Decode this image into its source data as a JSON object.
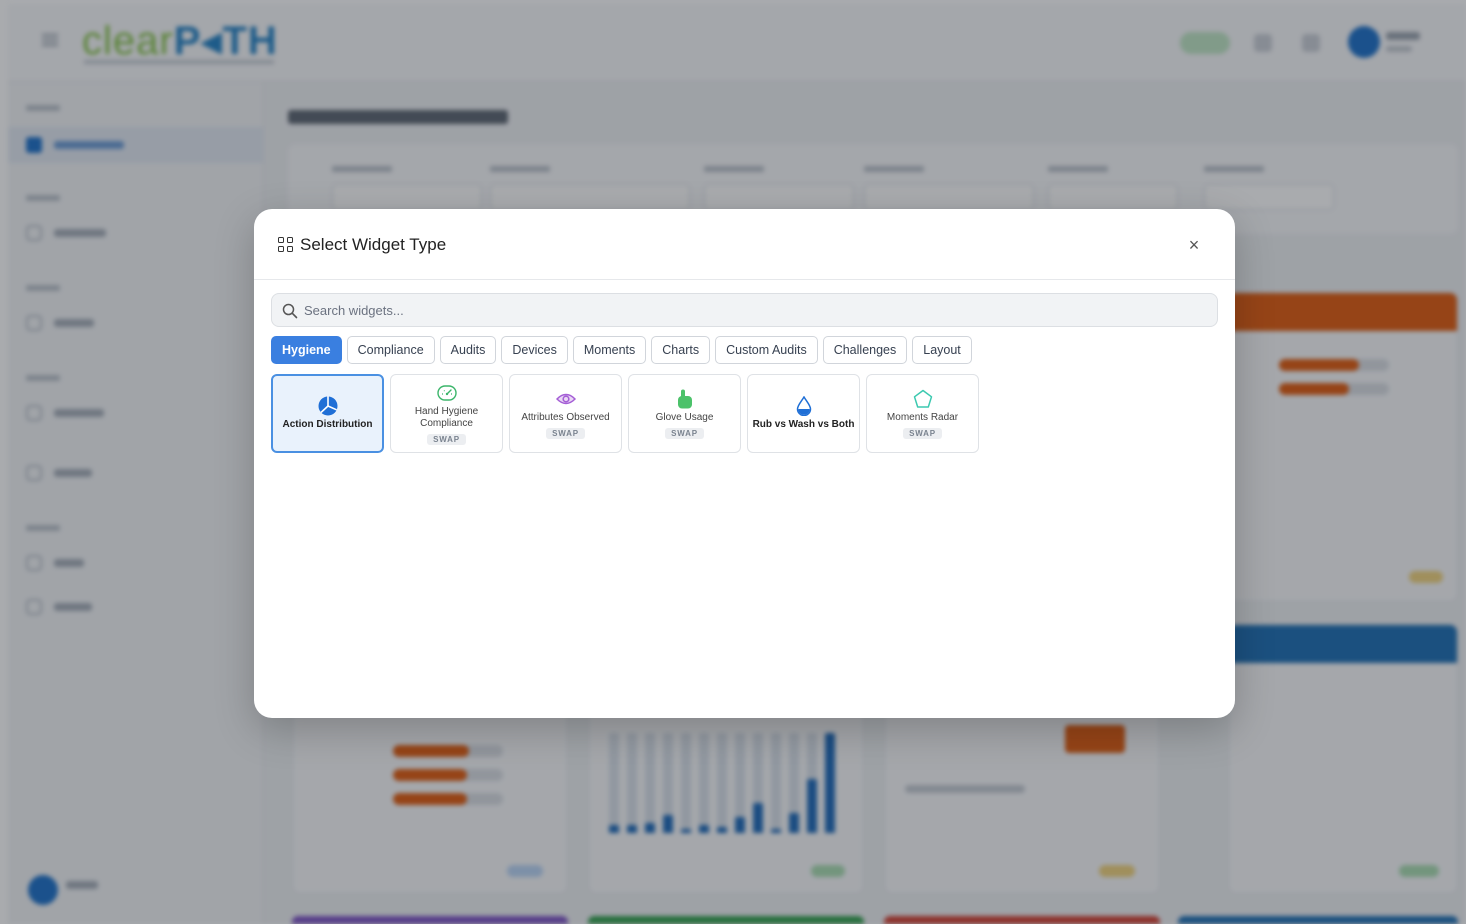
{
  "modal": {
    "title": "Select Widget Type",
    "close_label": "×",
    "search_placeholder": "Search widgets...",
    "tabs": [
      {
        "label": "Hygiene",
        "active": true
      },
      {
        "label": "Compliance"
      },
      {
        "label": "Audits"
      },
      {
        "label": "Devices"
      },
      {
        "label": "Moments"
      },
      {
        "label": "Charts"
      },
      {
        "label": "Custom Audits"
      },
      {
        "label": "Challenges"
      },
      {
        "label": "Layout"
      }
    ],
    "widgets": [
      {
        "label": "Action Distribution",
        "icon": "pie-chart-icon",
        "selected": true
      },
      {
        "label": "Hand Hygiene Compliance",
        "icon": "gauge-icon",
        "badge": "SWAP"
      },
      {
        "label": "Attributes Observed",
        "icon": "eye-icon",
        "badge": "SWAP"
      },
      {
        "label": "Glove Usage",
        "icon": "hand-pointer-icon",
        "badge": "SWAP"
      },
      {
        "label": "Rub vs Wash vs Both",
        "icon": "droplet-icon"
      },
      {
        "label": "Moments Radar",
        "icon": "pentagon-icon",
        "badge": "SWAP"
      }
    ]
  },
  "colors": {
    "accent": "#3a7fe0",
    "selected_bg": "#e9f2fc",
    "brand_blue": "#1f7fc4",
    "brand_green": "#7fbf3f"
  },
  "background": {
    "logo_part1": "clear",
    "logo_part2": "P◂TH"
  }
}
